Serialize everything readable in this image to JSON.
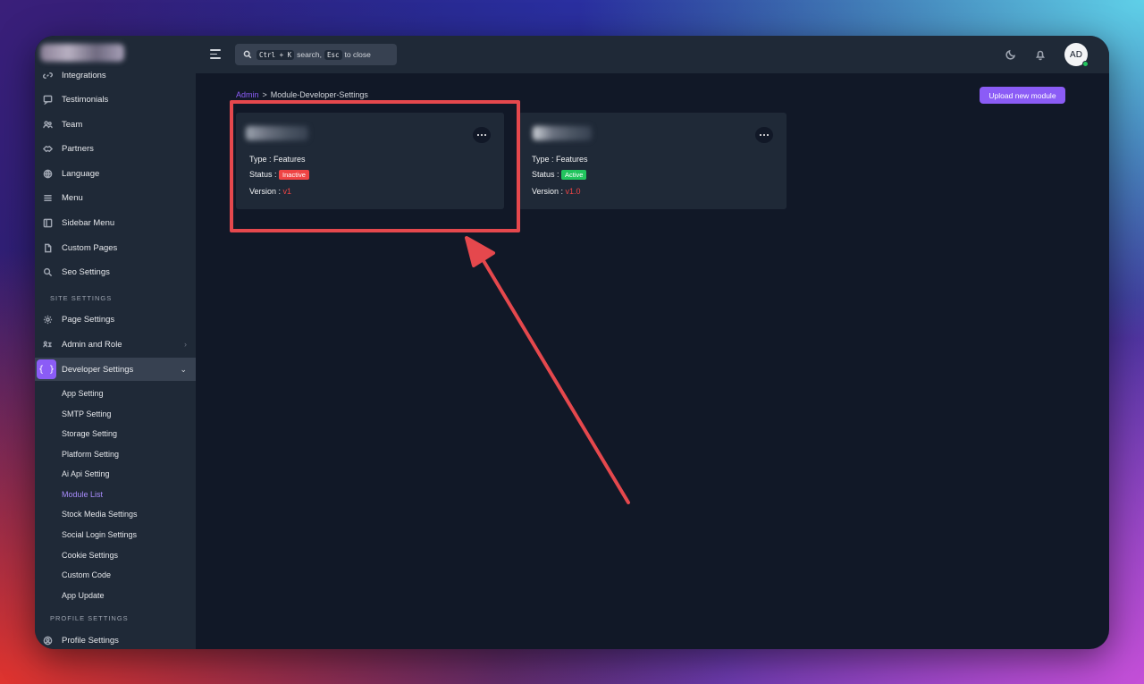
{
  "sidebar": {
    "items_top": [
      {
        "label": "Integrations",
        "icon": "link-icon"
      },
      {
        "label": "Testimonials",
        "icon": "chat-icon"
      },
      {
        "label": "Team",
        "icon": "users-icon"
      },
      {
        "label": "Partners",
        "icon": "handshake-icon"
      },
      {
        "label": "Language",
        "icon": "globe-icon"
      },
      {
        "label": "Menu",
        "icon": "menu-icon"
      },
      {
        "label": "Sidebar Menu",
        "icon": "layout-icon"
      },
      {
        "label": "Custom Pages",
        "icon": "file-icon"
      },
      {
        "label": "Seo Settings",
        "icon": "search-icon"
      }
    ],
    "site_settings_label": "SITE SETTINGS",
    "page_settings": "Page Settings",
    "admin_role": "Admin and Role",
    "developer_settings": "Developer Settings",
    "developer_icon": "{ }",
    "sub_items": [
      "App Setting",
      "SMTP Setting",
      "Storage Setting",
      "Platform Setting",
      "Ai Api Setting",
      "Module List",
      "Stock Media Settings",
      "Social Login Settings",
      "Cookie Settings",
      "Custom Code",
      "App Update"
    ],
    "current_sub_item": "Module List",
    "profile_settings_label": "PROFILE SETTINGS",
    "profile_settings": "Profile Settings"
  },
  "topbar": {
    "search_kbd1": "Ctrl + K",
    "search_text1": "search,",
    "search_kbd2": "Esc",
    "search_text2": "to close",
    "avatar_initials": "AD"
  },
  "breadcrumb": {
    "root": "Admin",
    "separator": ">",
    "current": "Module-Developer-Settings"
  },
  "upload_button": "Upload new module",
  "modules": [
    {
      "type_label": "Type :",
      "type": "Features",
      "status_label": "Status :",
      "status": "Inactive",
      "version_label": "Version :",
      "version": "v1"
    },
    {
      "type_label": "Type :",
      "type": "Features",
      "status_label": "Status :",
      "status": "Active",
      "version_label": "Version :",
      "version": "v1.0"
    }
  ],
  "colors": {
    "accent": "#8b5cf6",
    "inactive": "#ef4444",
    "active": "#22c55e",
    "annotation": "#e5484d"
  }
}
